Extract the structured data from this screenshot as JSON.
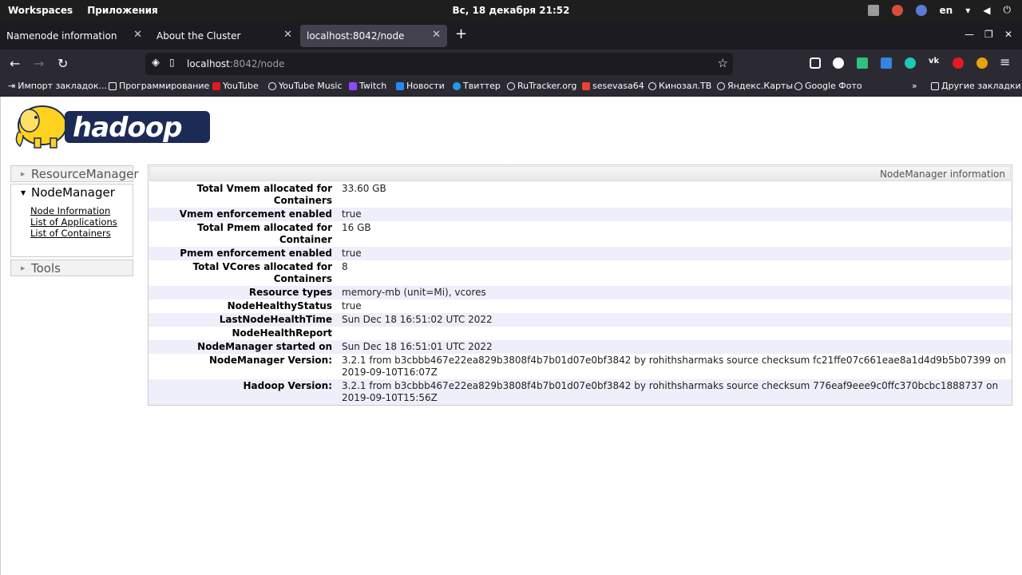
{
  "system_bar": {
    "workspaces": "Workspaces",
    "apps": "Приложения",
    "clock": "Вс, 18 декабря  21:52",
    "lang": "en"
  },
  "tabs": [
    {
      "title": "Namenode information",
      "close": "✕"
    },
    {
      "title": "About the Cluster",
      "close": "✕"
    },
    {
      "title": "localhost:8042/node",
      "close": "✕"
    }
  ],
  "new_tab": "+",
  "window_controls": {
    "minimize": "—",
    "restore": "❐",
    "close": "✕"
  },
  "url": {
    "host": "localhost",
    "path": ":8042/node"
  },
  "bookmarks": [
    "Импорт закладок...",
    "Программирование",
    "YouTube",
    "YouTube Music",
    "Twitch",
    "Новости",
    "Твиттер",
    "RuTracker.org",
    "sesevasa64",
    "Кинозал.ТВ",
    "Яндекс.Карты",
    "Google Фото"
  ],
  "bookmarks_other": "Другие закладки",
  "sidebar": {
    "resource_manager": "ResourceManager",
    "node_manager": "NodeManager",
    "links": [
      "Node Information",
      "List of Applications",
      "List of Containers"
    ],
    "tools": "Tools"
  },
  "info": {
    "header": "NodeManager information",
    "rows": [
      {
        "label": "Total Vmem allocated for Containers",
        "value": "33.60 GB"
      },
      {
        "label": "Vmem enforcement enabled",
        "value": "true"
      },
      {
        "label": "Total Pmem allocated for Container",
        "value": "16 GB"
      },
      {
        "label": "Pmem enforcement enabled",
        "value": "true"
      },
      {
        "label": "Total VCores allocated for Containers",
        "value": "8"
      },
      {
        "label": "Resource types",
        "value": "memory-mb (unit=Mi), vcores"
      },
      {
        "label": "NodeHealthyStatus",
        "value": "true"
      },
      {
        "label": "LastNodeHealthTime",
        "value": "Sun Dec 18 16:51:02 UTC 2022"
      },
      {
        "label": "NodeHealthReport",
        "value": ""
      },
      {
        "label": "NodeManager started on",
        "value": "Sun Dec 18 16:51:01 UTC 2022"
      },
      {
        "label": "NodeManager Version:",
        "value": "3.2.1 from b3cbbb467e22ea829b3808f4b7b01d07e0bf3842 by rohithsharmaks source checksum fc21ffe07c661eae8a1d4d9b5b07399 on 2019-09-10T16:07Z"
      },
      {
        "label": "Hadoop Version:",
        "value": "3.2.1 from b3cbbb467e22ea829b3808f4b7b01d07e0bf3842 by rohithsharmaks source checksum 776eaf9eee9c0ffc370bcbc1888737 on 2019-09-10T15:56Z"
      }
    ]
  },
  "colors": {
    "brand_yellow": "#ffd21f",
    "brand_navy": "#1c2a56"
  }
}
